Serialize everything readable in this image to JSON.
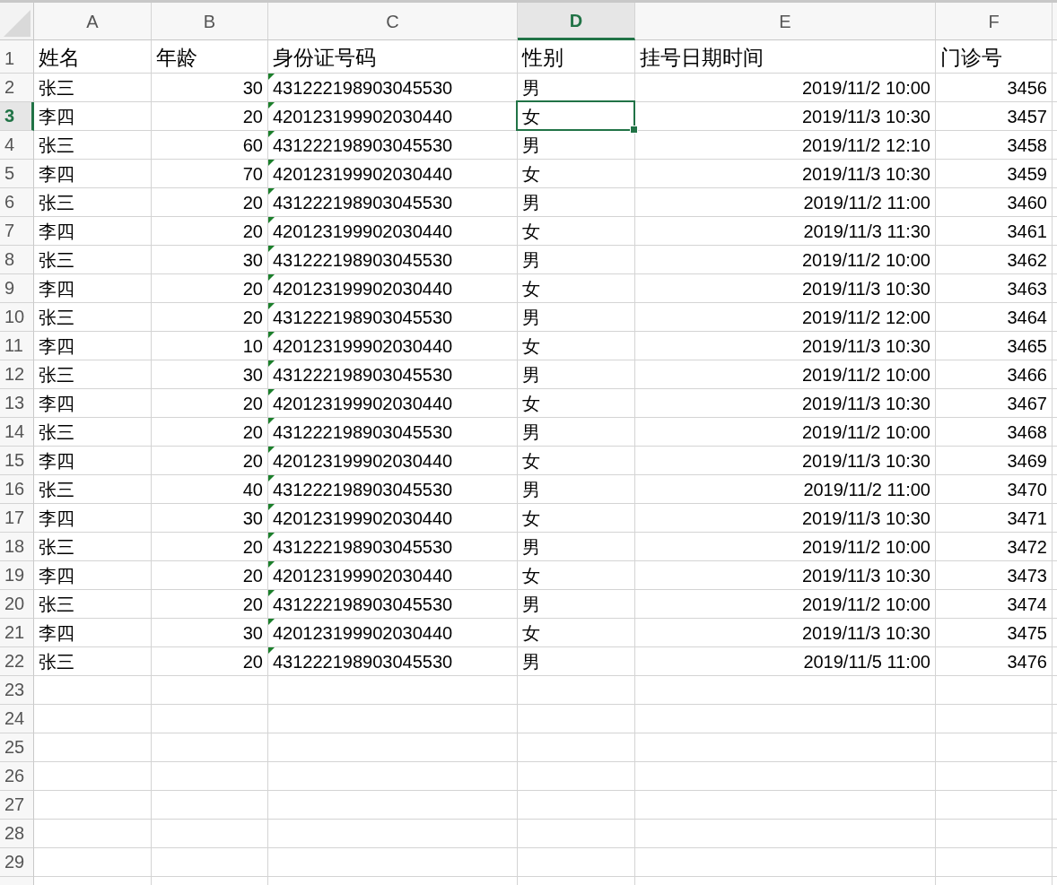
{
  "columns": [
    {
      "letter": "A",
      "kind": "text",
      "selected": false
    },
    {
      "letter": "B",
      "kind": "number",
      "selected": false
    },
    {
      "letter": "C",
      "kind": "number_as_text",
      "selected": false
    },
    {
      "letter": "D",
      "kind": "text",
      "selected": true
    },
    {
      "letter": "E",
      "kind": "number",
      "selected": false
    },
    {
      "letter": "F",
      "kind": "number",
      "selected": false
    }
  ],
  "rows": [
    {
      "number": "1",
      "kind": "header",
      "selected": false,
      "cells": [
        "姓名",
        "年龄",
        "身份证号码",
        "性别",
        "挂号日期时间",
        "门诊号"
      ]
    },
    {
      "number": "2",
      "kind": "data",
      "selected": false,
      "cells": [
        "张三",
        "30",
        "431222198903045530",
        "男",
        "2019/11/2 10:00",
        "3456"
      ]
    },
    {
      "number": "3",
      "kind": "data",
      "selected": true,
      "cells": [
        "李四",
        "20",
        "420123199902030440",
        "女",
        "2019/11/3 10:30",
        "3457"
      ]
    },
    {
      "number": "4",
      "kind": "data",
      "selected": false,
      "cells": [
        "张三",
        "60",
        "431222198903045530",
        "男",
        "2019/11/2 12:10",
        "3458"
      ]
    },
    {
      "number": "5",
      "kind": "data",
      "selected": false,
      "cells": [
        "李四",
        "70",
        "420123199902030440",
        "女",
        "2019/11/3 10:30",
        "3459"
      ]
    },
    {
      "number": "6",
      "kind": "data",
      "selected": false,
      "cells": [
        "张三",
        "20",
        "431222198903045530",
        "男",
        "2019/11/2 11:00",
        "3460"
      ]
    },
    {
      "number": "7",
      "kind": "data",
      "selected": false,
      "cells": [
        "李四",
        "20",
        "420123199902030440",
        "女",
        "2019/11/3 11:30",
        "3461"
      ]
    },
    {
      "number": "8",
      "kind": "data",
      "selected": false,
      "cells": [
        "张三",
        "30",
        "431222198903045530",
        "男",
        "2019/11/2 10:00",
        "3462"
      ]
    },
    {
      "number": "9",
      "kind": "data",
      "selected": false,
      "cells": [
        "李四",
        "20",
        "420123199902030440",
        "女",
        "2019/11/3 10:30",
        "3463"
      ]
    },
    {
      "number": "10",
      "kind": "data",
      "selected": false,
      "cells": [
        "张三",
        "20",
        "431222198903045530",
        "男",
        "2019/11/2 12:00",
        "3464"
      ]
    },
    {
      "number": "11",
      "kind": "data",
      "selected": false,
      "cells": [
        "李四",
        "10",
        "420123199902030440",
        "女",
        "2019/11/3 10:30",
        "3465"
      ]
    },
    {
      "number": "12",
      "kind": "data",
      "selected": false,
      "cells": [
        "张三",
        "30",
        "431222198903045530",
        "男",
        "2019/11/2 10:00",
        "3466"
      ]
    },
    {
      "number": "13",
      "kind": "data",
      "selected": false,
      "cells": [
        "李四",
        "20",
        "420123199902030440",
        "女",
        "2019/11/3 10:30",
        "3467"
      ]
    },
    {
      "number": "14",
      "kind": "data",
      "selected": false,
      "cells": [
        "张三",
        "20",
        "431222198903045530",
        "男",
        "2019/11/2 10:00",
        "3468"
      ]
    },
    {
      "number": "15",
      "kind": "data",
      "selected": false,
      "cells": [
        "李四",
        "20",
        "420123199902030440",
        "女",
        "2019/11/3 10:30",
        "3469"
      ]
    },
    {
      "number": "16",
      "kind": "data",
      "selected": false,
      "cells": [
        "张三",
        "40",
        "431222198903045530",
        "男",
        "2019/11/2 11:00",
        "3470"
      ]
    },
    {
      "number": "17",
      "kind": "data",
      "selected": false,
      "cells": [
        "李四",
        "30",
        "420123199902030440",
        "女",
        "2019/11/3 10:30",
        "3471"
      ]
    },
    {
      "number": "18",
      "kind": "data",
      "selected": false,
      "cells": [
        "张三",
        "20",
        "431222198903045530",
        "男",
        "2019/11/2 10:00",
        "3472"
      ]
    },
    {
      "number": "19",
      "kind": "data",
      "selected": false,
      "cells": [
        "李四",
        "20",
        "420123199902030440",
        "女",
        "2019/11/3 10:30",
        "3473"
      ]
    },
    {
      "number": "20",
      "kind": "data",
      "selected": false,
      "cells": [
        "张三",
        "20",
        "431222198903045530",
        "男",
        "2019/11/2 10:00",
        "3474"
      ]
    },
    {
      "number": "21",
      "kind": "data",
      "selected": false,
      "cells": [
        "李四",
        "30",
        "420123199902030440",
        "女",
        "2019/11/3 10:30",
        "3475"
      ]
    },
    {
      "number": "22",
      "kind": "data",
      "selected": false,
      "cells": [
        "张三",
        "20",
        "431222198903045530",
        "男",
        "2019/11/5 11:00",
        "3476"
      ]
    },
    {
      "number": "23",
      "kind": "empty",
      "selected": false
    },
    {
      "number": "24",
      "kind": "empty",
      "selected": false
    },
    {
      "number": "25",
      "kind": "empty",
      "selected": false
    },
    {
      "number": "26",
      "kind": "empty",
      "selected": false
    },
    {
      "number": "27",
      "kind": "empty",
      "selected": false
    },
    {
      "number": "28",
      "kind": "empty",
      "selected": false
    },
    {
      "number": "29",
      "kind": "empty",
      "selected": false
    }
  ]
}
